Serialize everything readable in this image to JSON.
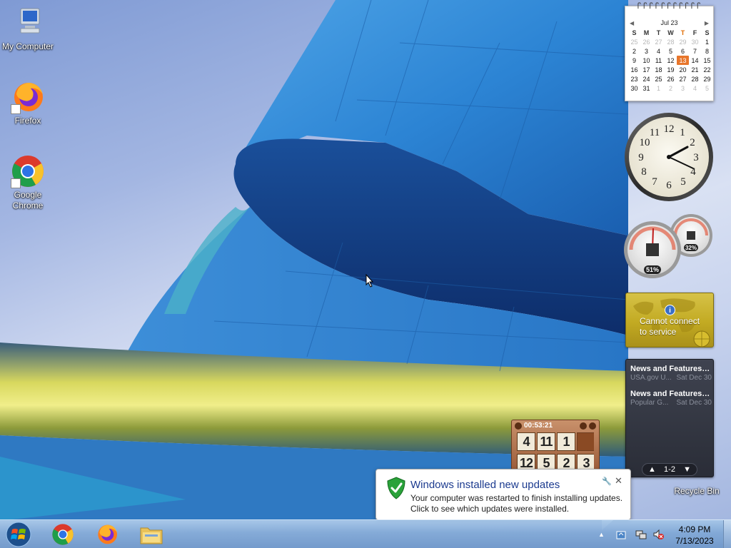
{
  "desktop": {
    "icons": [
      {
        "label": "My Computer",
        "icon": "computer-icon"
      },
      {
        "label": "Firefox",
        "icon": "firefox-icon"
      },
      {
        "label": "Google Chrome",
        "icon": "chrome-icon"
      }
    ],
    "recycle_bin_label": "Recycle Bin"
  },
  "gadgets": {
    "calendar": {
      "month_label": "Jul 23",
      "weekdays": [
        "S",
        "M",
        "T",
        "W",
        "T",
        "F",
        "S"
      ],
      "weeks": [
        [
          "25",
          "26",
          "27",
          "28",
          "29",
          "30",
          "1"
        ],
        [
          "2",
          "3",
          "4",
          "5",
          "6",
          "7",
          "8"
        ],
        [
          "9",
          "10",
          "11",
          "12",
          "13",
          "14",
          "15"
        ],
        [
          "16",
          "17",
          "18",
          "19",
          "20",
          "21",
          "22"
        ],
        [
          "23",
          "24",
          "25",
          "26",
          "27",
          "28",
          "29"
        ],
        [
          "30",
          "31",
          "1",
          "2",
          "3",
          "4",
          "5"
        ]
      ],
      "today": "13",
      "today_color": "#e8762b"
    },
    "clock": {
      "numerals": [
        "12",
        "1",
        "2",
        "3",
        "4",
        "5",
        "6",
        "7",
        "8",
        "9",
        "10",
        "11"
      ],
      "time": "4:09"
    },
    "cpu_meter": {
      "cpu_percent": "51%",
      "memory_percent": "32%"
    },
    "currency": {
      "message": "Cannot connect to service",
      "message_line1": "Cannot connect",
      "message_line2": "to service"
    },
    "feeds": {
      "items": [
        {
          "title": "News and Features f...",
          "source": "USA.gov U...",
          "date": "Sat Dec 30"
        },
        {
          "title": "News and Features f...",
          "source": "Popular G...",
          "date": "Sat Dec 30"
        }
      ],
      "pager": "1-2"
    },
    "puzzle": {
      "timer": "00:53:21",
      "tiles": [
        "4",
        "11",
        "1",
        "",
        "12",
        "5",
        "2",
        "3"
      ]
    }
  },
  "notification": {
    "title": "Windows installed new updates",
    "line1": "Your computer was restarted to finish installing updates.",
    "line2": "Click to see which updates were installed."
  },
  "taskbar": {
    "pinned": [
      {
        "name": "chrome",
        "icon": "chrome-icon"
      },
      {
        "name": "firefox",
        "icon": "firefox-icon"
      },
      {
        "name": "explorer",
        "icon": "folder-icon"
      }
    ],
    "clock_time": "4:09 PM",
    "clock_date": "7/13/2023"
  }
}
